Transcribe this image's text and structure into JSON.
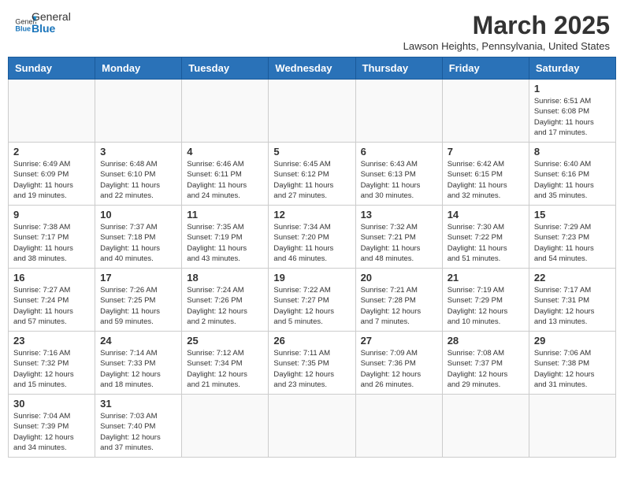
{
  "header": {
    "logo_general": "General",
    "logo_blue": "Blue",
    "month_title": "March 2025",
    "location": "Lawson Heights, Pennsylvania, United States"
  },
  "weekdays": [
    "Sunday",
    "Monday",
    "Tuesday",
    "Wednesday",
    "Thursday",
    "Friday",
    "Saturday"
  ],
  "weeks": [
    [
      {
        "day": "",
        "info": ""
      },
      {
        "day": "",
        "info": ""
      },
      {
        "day": "",
        "info": ""
      },
      {
        "day": "",
        "info": ""
      },
      {
        "day": "",
        "info": ""
      },
      {
        "day": "",
        "info": ""
      },
      {
        "day": "1",
        "info": "Sunrise: 6:51 AM\nSunset: 6:08 PM\nDaylight: 11 hours\nand 17 minutes."
      }
    ],
    [
      {
        "day": "2",
        "info": "Sunrise: 6:49 AM\nSunset: 6:09 PM\nDaylight: 11 hours\nand 19 minutes."
      },
      {
        "day": "3",
        "info": "Sunrise: 6:48 AM\nSunset: 6:10 PM\nDaylight: 11 hours\nand 22 minutes."
      },
      {
        "day": "4",
        "info": "Sunrise: 6:46 AM\nSunset: 6:11 PM\nDaylight: 11 hours\nand 24 minutes."
      },
      {
        "day": "5",
        "info": "Sunrise: 6:45 AM\nSunset: 6:12 PM\nDaylight: 11 hours\nand 27 minutes."
      },
      {
        "day": "6",
        "info": "Sunrise: 6:43 AM\nSunset: 6:13 PM\nDaylight: 11 hours\nand 30 minutes."
      },
      {
        "day": "7",
        "info": "Sunrise: 6:42 AM\nSunset: 6:15 PM\nDaylight: 11 hours\nand 32 minutes."
      },
      {
        "day": "8",
        "info": "Sunrise: 6:40 AM\nSunset: 6:16 PM\nDaylight: 11 hours\nand 35 minutes."
      }
    ],
    [
      {
        "day": "9",
        "info": "Sunrise: 7:38 AM\nSunset: 7:17 PM\nDaylight: 11 hours\nand 38 minutes."
      },
      {
        "day": "10",
        "info": "Sunrise: 7:37 AM\nSunset: 7:18 PM\nDaylight: 11 hours\nand 40 minutes."
      },
      {
        "day": "11",
        "info": "Sunrise: 7:35 AM\nSunset: 7:19 PM\nDaylight: 11 hours\nand 43 minutes."
      },
      {
        "day": "12",
        "info": "Sunrise: 7:34 AM\nSunset: 7:20 PM\nDaylight: 11 hours\nand 46 minutes."
      },
      {
        "day": "13",
        "info": "Sunrise: 7:32 AM\nSunset: 7:21 PM\nDaylight: 11 hours\nand 48 minutes."
      },
      {
        "day": "14",
        "info": "Sunrise: 7:30 AM\nSunset: 7:22 PM\nDaylight: 11 hours\nand 51 minutes."
      },
      {
        "day": "15",
        "info": "Sunrise: 7:29 AM\nSunset: 7:23 PM\nDaylight: 11 hours\nand 54 minutes."
      }
    ],
    [
      {
        "day": "16",
        "info": "Sunrise: 7:27 AM\nSunset: 7:24 PM\nDaylight: 11 hours\nand 57 minutes."
      },
      {
        "day": "17",
        "info": "Sunrise: 7:26 AM\nSunset: 7:25 PM\nDaylight: 11 hours\nand 59 minutes."
      },
      {
        "day": "18",
        "info": "Sunrise: 7:24 AM\nSunset: 7:26 PM\nDaylight: 12 hours\nand 2 minutes."
      },
      {
        "day": "19",
        "info": "Sunrise: 7:22 AM\nSunset: 7:27 PM\nDaylight: 12 hours\nand 5 minutes."
      },
      {
        "day": "20",
        "info": "Sunrise: 7:21 AM\nSunset: 7:28 PM\nDaylight: 12 hours\nand 7 minutes."
      },
      {
        "day": "21",
        "info": "Sunrise: 7:19 AM\nSunset: 7:29 PM\nDaylight: 12 hours\nand 10 minutes."
      },
      {
        "day": "22",
        "info": "Sunrise: 7:17 AM\nSunset: 7:31 PM\nDaylight: 12 hours\nand 13 minutes."
      }
    ],
    [
      {
        "day": "23",
        "info": "Sunrise: 7:16 AM\nSunset: 7:32 PM\nDaylight: 12 hours\nand 15 minutes."
      },
      {
        "day": "24",
        "info": "Sunrise: 7:14 AM\nSunset: 7:33 PM\nDaylight: 12 hours\nand 18 minutes."
      },
      {
        "day": "25",
        "info": "Sunrise: 7:12 AM\nSunset: 7:34 PM\nDaylight: 12 hours\nand 21 minutes."
      },
      {
        "day": "26",
        "info": "Sunrise: 7:11 AM\nSunset: 7:35 PM\nDaylight: 12 hours\nand 23 minutes."
      },
      {
        "day": "27",
        "info": "Sunrise: 7:09 AM\nSunset: 7:36 PM\nDaylight: 12 hours\nand 26 minutes."
      },
      {
        "day": "28",
        "info": "Sunrise: 7:08 AM\nSunset: 7:37 PM\nDaylight: 12 hours\nand 29 minutes."
      },
      {
        "day": "29",
        "info": "Sunrise: 7:06 AM\nSunset: 7:38 PM\nDaylight: 12 hours\nand 31 minutes."
      }
    ],
    [
      {
        "day": "30",
        "info": "Sunrise: 7:04 AM\nSunset: 7:39 PM\nDaylight: 12 hours\nand 34 minutes."
      },
      {
        "day": "31",
        "info": "Sunrise: 7:03 AM\nSunset: 7:40 PM\nDaylight: 12 hours\nand 37 minutes."
      },
      {
        "day": "",
        "info": ""
      },
      {
        "day": "",
        "info": ""
      },
      {
        "day": "",
        "info": ""
      },
      {
        "day": "",
        "info": ""
      },
      {
        "day": "",
        "info": ""
      }
    ]
  ]
}
